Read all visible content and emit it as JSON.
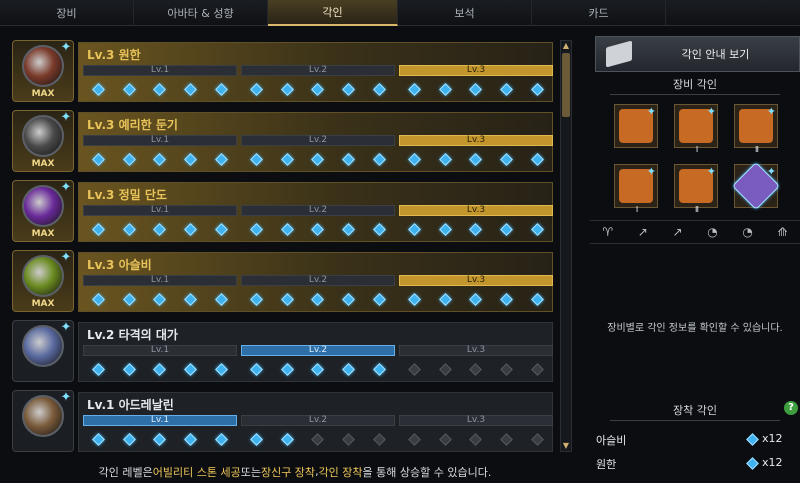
{
  "tabs": [
    {
      "label": "장비"
    },
    {
      "label": "아바타 & 성향"
    },
    {
      "label": "각인",
      "active": true
    },
    {
      "label": "보석"
    },
    {
      "label": "카드"
    }
  ],
  "engravings": [
    {
      "title": "Lv.3 원한",
      "max": true,
      "max_label": "MAX",
      "level": 3,
      "levels": [
        "Lv.1",
        "Lv.2",
        "Lv.3"
      ],
      "nodes_filled": 15,
      "nodes_total": 15
    },
    {
      "title": "Lv.3 예리한 둔기",
      "max": true,
      "max_label": "MAX",
      "level": 3,
      "levels": [
        "Lv.1",
        "Lv.2",
        "Lv.3"
      ],
      "nodes_filled": 15,
      "nodes_total": 15
    },
    {
      "title": "Lv.3 정밀 단도",
      "max": true,
      "max_label": "MAX",
      "level": 3,
      "levels": [
        "Lv.1",
        "Lv.2",
        "Lv.3"
      ],
      "nodes_filled": 15,
      "nodes_total": 15
    },
    {
      "title": "Lv.3 아슬비",
      "max": true,
      "max_label": "MAX",
      "level": 3,
      "levels": [
        "Lv.1",
        "Lv.2",
        "Lv.3"
      ],
      "nodes_filled": 15,
      "nodes_total": 15
    },
    {
      "title": "Lv.2 타격의 대가",
      "max": false,
      "max_label": "",
      "level": 2,
      "levels": [
        "Lv.1",
        "Lv.2",
        "Lv.3"
      ],
      "nodes_filled": 10,
      "nodes_total": 15
    },
    {
      "title": "Lv.1 아드레날린",
      "max": false,
      "max_label": "",
      "level": 1,
      "levels": [
        "Lv.1",
        "Lv.2",
        "Lv.3"
      ],
      "nodes_filled": 7,
      "nodes_total": 15
    }
  ],
  "footer": {
    "prefix": "각인 레벨은 ",
    "hl1": "어빌리티 스톤 세공",
    "mid1": " 또는 ",
    "hl2": "장신구 장착",
    "mid2": ", ",
    "hl3": "각인 장착",
    "suffix": "을 통해 상승할 수 있습니다."
  },
  "right_panel": {
    "guide_button_label": "각인 안내 보기",
    "equip_section_title": "장비 각인",
    "slots": [
      {
        "icon": "necklace-icon",
        "roman": ""
      },
      {
        "icon": "earring-icon",
        "roman": "Ⅰ"
      },
      {
        "icon": "earring-icon",
        "roman": "Ⅱ"
      },
      {
        "icon": "ring-icon",
        "roman": "Ⅰ"
      },
      {
        "icon": "ring-icon",
        "roman": "Ⅱ"
      },
      {
        "icon": "ability-stone-icon",
        "roman": ""
      }
    ],
    "filter_icons": [
      "necklace-filter-icon",
      "earring-1-filter-icon",
      "earring-2-filter-icon",
      "ring-1-filter-icon",
      "ring-2-filter-icon",
      "stone-filter-icon"
    ],
    "hint_text": "장비별로 각인 정보를 확인할 수 있습니다.",
    "mounted_section_title": "장착 각인",
    "help_label": "?",
    "mounted": [
      {
        "name": "아슬비",
        "value": "x12"
      },
      {
        "name": "원한",
        "value": "x12"
      }
    ]
  },
  "colors": {
    "gold": "#e8c35a",
    "node_blue": "#3fb2f0",
    "active_tab": "#d8b66a"
  }
}
